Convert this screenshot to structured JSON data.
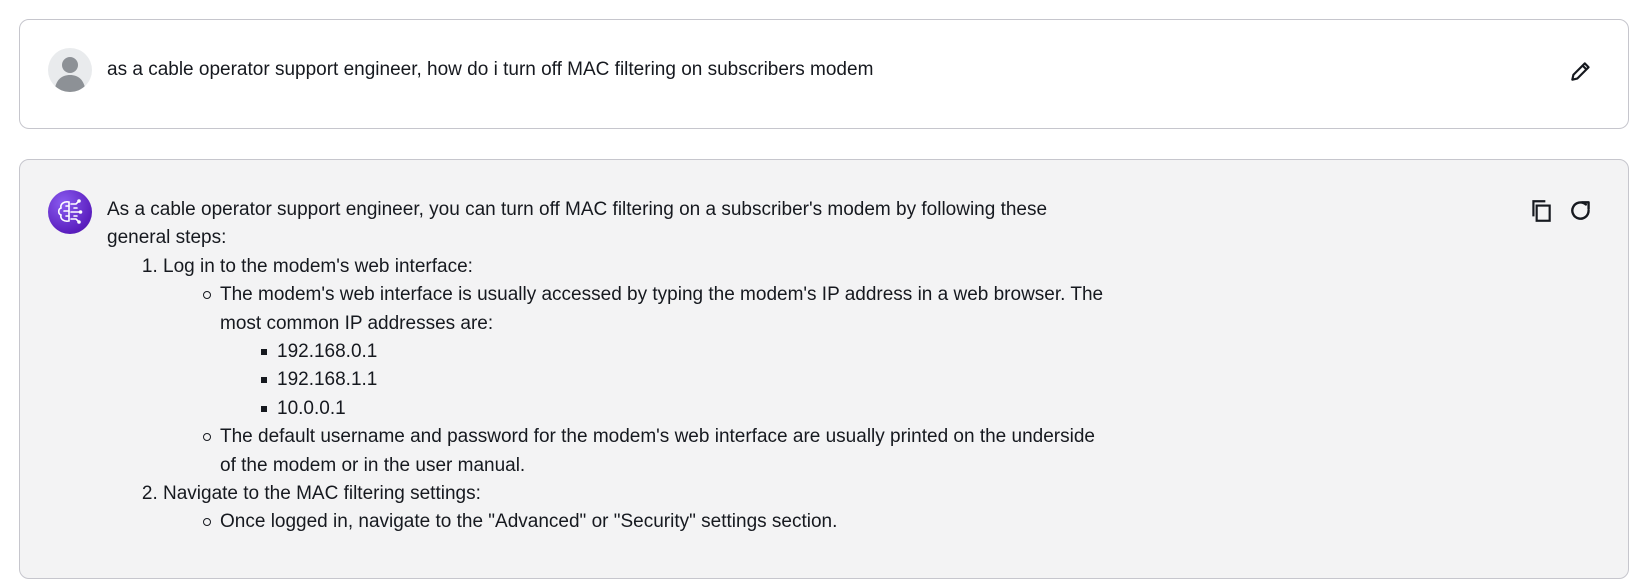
{
  "user_message": {
    "text": "as a cable operator support engineer, how do i turn off MAC filtering on subscribers modem",
    "edit_icon": "pencil-icon"
  },
  "assistant_message": {
    "intro": "As a cable operator support engineer, you can turn off MAC filtering on a subscriber's modem by following these general steps:",
    "steps": [
      {
        "title": "Log in to the modem's web interface:",
        "points": [
          {
            "text": "The modem's web interface is usually accessed by typing the modem's IP address in a web browser. The most common IP addresses are:",
            "sub": [
              "192.168.0.1",
              "192.168.1.1",
              "10.0.0.1"
            ]
          },
          {
            "text": "The default username and password for the modem's web interface are usually printed on the underside of the modem or in the user manual."
          }
        ]
      },
      {
        "title": "Navigate to the MAC filtering settings:",
        "points": [
          {
            "text": "Once logged in, navigate to the \"Advanced\" or \"Security\" settings section."
          }
        ]
      }
    ],
    "copy_icon": "copy-icon",
    "regenerate_icon": "refresh-icon"
  },
  "colors": {
    "accent": "#6a2dd6",
    "border": "#c6c6cd",
    "assistant_bg": "#f3f3f4",
    "text": "#16191f"
  }
}
